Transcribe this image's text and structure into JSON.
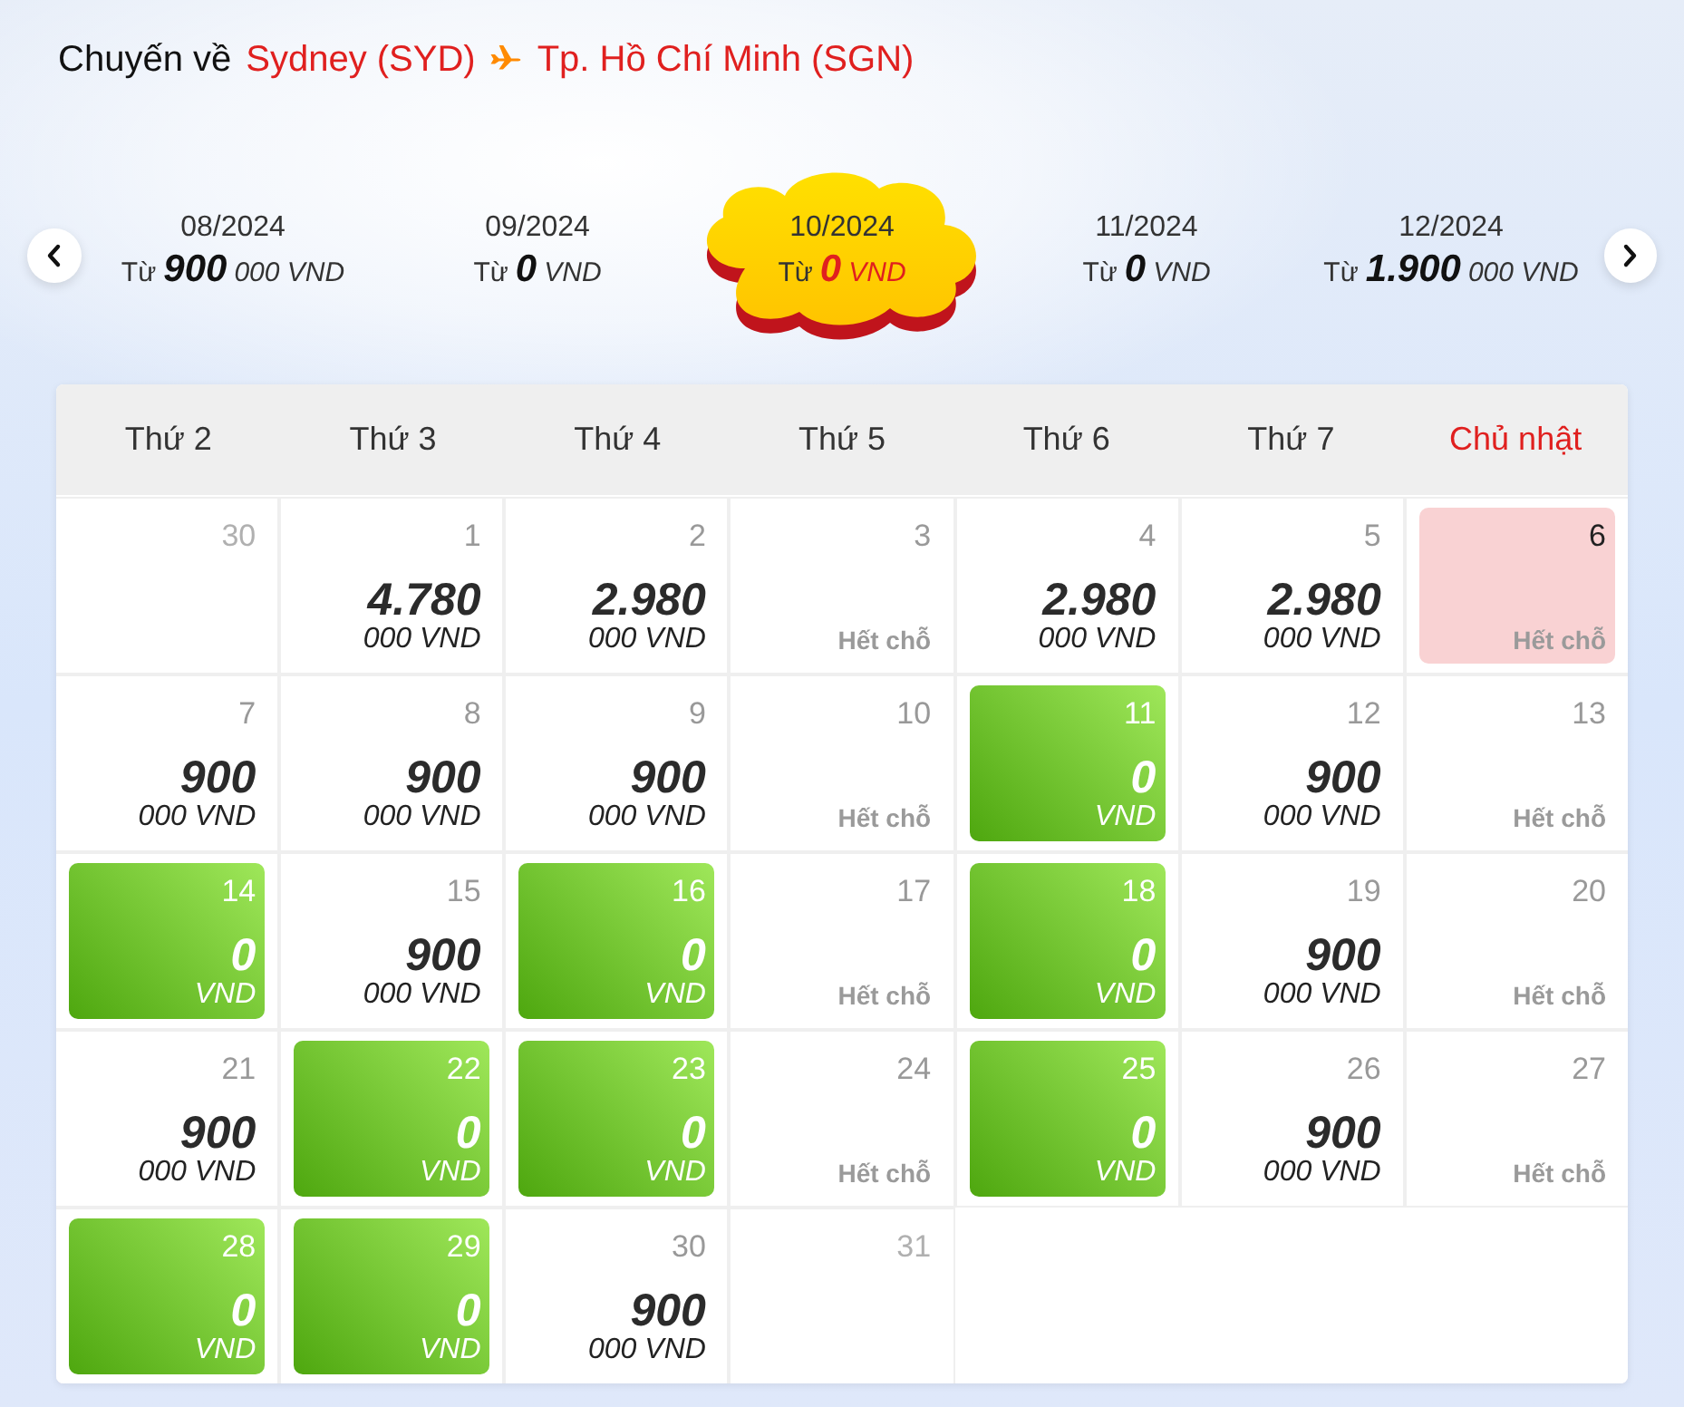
{
  "heading": {
    "label": "Chuyến về",
    "origin": "Sydney (SYD)",
    "destination": "Tp. Hồ Chí Minh (SGN)"
  },
  "months": [
    {
      "label": "08/2024",
      "prefix": "Từ",
      "amount": "900",
      "unit": "000 VND",
      "selected": false
    },
    {
      "label": "09/2024",
      "prefix": "Từ",
      "amount": "0",
      "unit": "VND",
      "selected": false
    },
    {
      "label": "10/2024",
      "prefix": "Từ",
      "amount": "0",
      "unit": "VND",
      "selected": true
    },
    {
      "label": "11/2024",
      "prefix": "Từ",
      "amount": "0",
      "unit": "VND",
      "selected": false
    },
    {
      "label": "12/2024",
      "prefix": "Từ",
      "amount": "1.900",
      "unit": "000 VND",
      "selected": false
    }
  ],
  "weekdays": [
    {
      "label": "Thứ 2",
      "color": "#333333"
    },
    {
      "label": "Thứ 3",
      "color": "#333333"
    },
    {
      "label": "Thứ 4",
      "color": "#333333"
    },
    {
      "label": "Thứ 5",
      "color": "#333333"
    },
    {
      "label": "Thứ 6",
      "color": "#333333"
    },
    {
      "label": "Thứ 7",
      "color": "#333333"
    },
    {
      "label": "Chủ nhật",
      "color": "#e0201f"
    }
  ],
  "days": [
    {
      "day": "30",
      "kind": "outside",
      "selected": false
    },
    {
      "day": "1",
      "kind": "price",
      "amount": "4.780",
      "unit": "000 VND",
      "selected": false
    },
    {
      "day": "2",
      "kind": "price",
      "amount": "2.980",
      "unit": "000 VND",
      "selected": false
    },
    {
      "day": "3",
      "kind": "soldout",
      "note": "Hết chỗ",
      "selected": false
    },
    {
      "day": "4",
      "kind": "price",
      "amount": "2.980",
      "unit": "000 VND",
      "selected": false
    },
    {
      "day": "5",
      "kind": "price",
      "amount": "2.980",
      "unit": "000 VND",
      "selected": false
    },
    {
      "day": "6",
      "kind": "soldout",
      "note": "Hết chỗ",
      "selected": true
    },
    {
      "day": "7",
      "kind": "price",
      "amount": "900",
      "unit": "000 VND",
      "selected": false
    },
    {
      "day": "8",
      "kind": "price",
      "amount": "900",
      "unit": "000 VND",
      "selected": false
    },
    {
      "day": "9",
      "kind": "price",
      "amount": "900",
      "unit": "000 VND",
      "selected": false
    },
    {
      "day": "10",
      "kind": "soldout",
      "note": "Hết chỗ",
      "selected": false
    },
    {
      "day": "11",
      "kind": "promo",
      "amount": "0",
      "unit": "VND",
      "selected": false
    },
    {
      "day": "12",
      "kind": "price",
      "amount": "900",
      "unit": "000 VND",
      "selected": false
    },
    {
      "day": "13",
      "kind": "soldout",
      "note": "Hết chỗ",
      "selected": false
    },
    {
      "day": "14",
      "kind": "promo",
      "amount": "0",
      "unit": "VND",
      "selected": false
    },
    {
      "day": "15",
      "kind": "price",
      "amount": "900",
      "unit": "000 VND",
      "selected": false
    },
    {
      "day": "16",
      "kind": "promo",
      "amount": "0",
      "unit": "VND",
      "selected": false
    },
    {
      "day": "17",
      "kind": "soldout",
      "note": "Hết chỗ",
      "selected": false
    },
    {
      "day": "18",
      "kind": "promo",
      "amount": "0",
      "unit": "VND",
      "selected": false
    },
    {
      "day": "19",
      "kind": "price",
      "amount": "900",
      "unit": "000 VND",
      "selected": false
    },
    {
      "day": "20",
      "kind": "soldout",
      "note": "Hết chỗ",
      "selected": false
    },
    {
      "day": "21",
      "kind": "price",
      "amount": "900",
      "unit": "000 VND",
      "selected": false
    },
    {
      "day": "22",
      "kind": "promo",
      "amount": "0",
      "unit": "VND",
      "selected": false
    },
    {
      "day": "23",
      "kind": "promo",
      "amount": "0",
      "unit": "VND",
      "selected": false
    },
    {
      "day": "24",
      "kind": "soldout",
      "note": "Hết chỗ",
      "selected": false
    },
    {
      "day": "25",
      "kind": "promo",
      "amount": "0",
      "unit": "VND",
      "selected": false
    },
    {
      "day": "26",
      "kind": "price",
      "amount": "900",
      "unit": "000 VND",
      "selected": false
    },
    {
      "day": "27",
      "kind": "soldout",
      "note": "Hết chỗ",
      "selected": false
    },
    {
      "day": "28",
      "kind": "promo",
      "amount": "0",
      "unit": "VND",
      "selected": false
    },
    {
      "day": "29",
      "kind": "promo",
      "amount": "0",
      "unit": "VND",
      "selected": false
    },
    {
      "day": "30",
      "kind": "price",
      "amount": "900",
      "unit": "000 VND",
      "selected": false
    },
    {
      "day": "31",
      "kind": "outside",
      "selected": false
    }
  ]
}
